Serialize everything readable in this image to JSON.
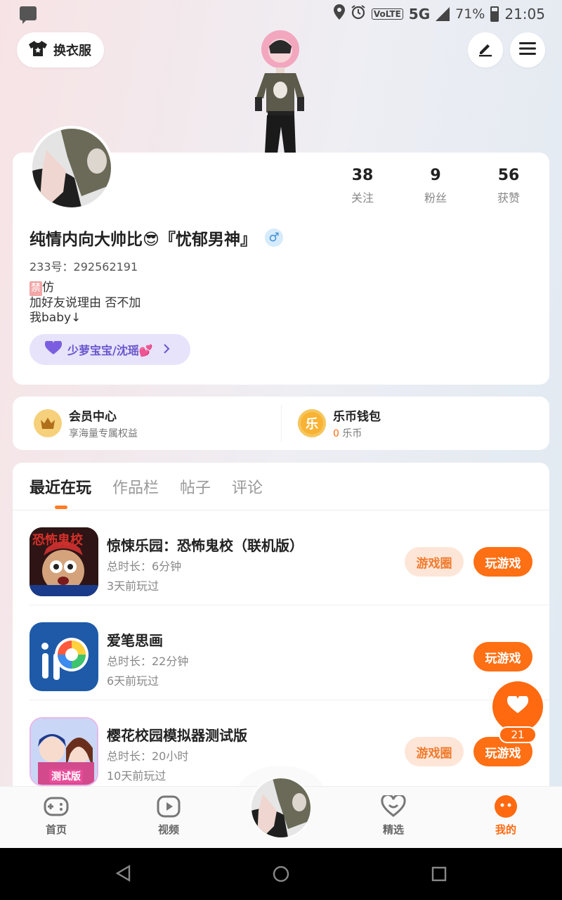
{
  "status_bar": {
    "icons": [
      "message-icon",
      "location-icon",
      "alarm-icon"
    ],
    "volte": "VoLTE",
    "network": "5G",
    "battery": "71%",
    "time": "21:05"
  },
  "top": {
    "dress_button": "换衣服"
  },
  "profile": {
    "stats": [
      {
        "num": "38",
        "label": "关注"
      },
      {
        "num": "9",
        "label": "粉丝"
      },
      {
        "num": "56",
        "label": "获赞"
      }
    ],
    "nickname": "纯情内向大帅比😎『忧郁男神』",
    "gender": "♂",
    "uid": "233号：292562191",
    "bio_tag": "禁",
    "bio_line1": "仿",
    "bio_line2": "加好友说理由 否不加",
    "bio_line3": "我baby↓",
    "link_label": "少萝宝宝/沈瑶💕"
  },
  "member": {
    "left_title": "会员中心",
    "left_sub": "享海量专属权益",
    "right_title": "乐币钱包",
    "right_coin_glyph": "乐",
    "right_count": "0",
    "right_unit": "乐币"
  },
  "tabs": [
    "最近在玩",
    "作品栏",
    "帖子",
    "评论"
  ],
  "games": [
    {
      "title": "惊悚乐园：恐怖鬼校（联机版）",
      "duration": "总时长：6分钟",
      "last": "3天前玩过",
      "circle_btn": "游戏圈",
      "play_btn": "玩游戏",
      "icon_text": "恐怖鬼校"
    },
    {
      "title": "爱笔思画",
      "duration": "总时长：22分钟",
      "last": "6天前玩过",
      "play_btn": "玩游戏"
    },
    {
      "title": "樱花校园模拟器测试版",
      "duration": "总时长：20小时",
      "last": "10天前玩过",
      "circle_btn": "游戏圈",
      "play_btn": "玩游戏",
      "icon_text": "测试版"
    }
  ],
  "float": {
    "count": "21"
  },
  "bottom_nav": [
    {
      "label": "首页"
    },
    {
      "label": "视频"
    },
    {
      "label": "精选"
    },
    {
      "label": "我的"
    }
  ],
  "colors": {
    "accent": "#ff6a10",
    "pill": "#e6e3fb"
  }
}
